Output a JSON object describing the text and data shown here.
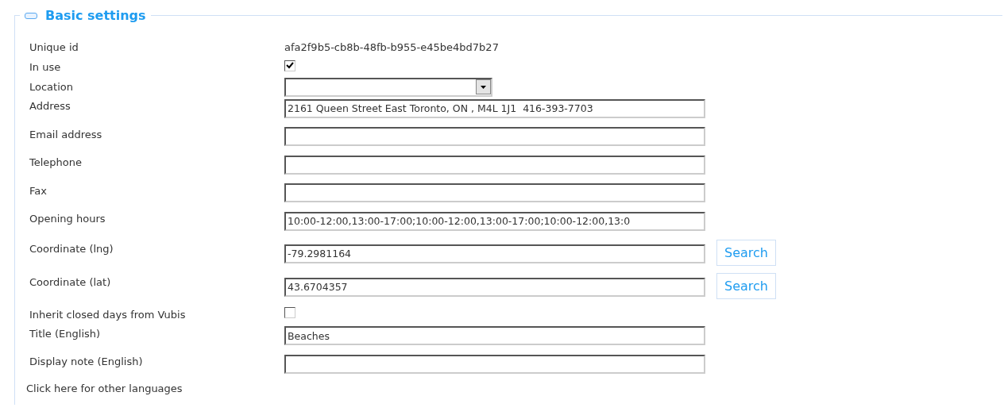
{
  "section": {
    "title": "Basic settings",
    "expanded": true
  },
  "fields": [
    {
      "kind": "text",
      "label": "Unique id",
      "value": "afa2f9b5-cb8b-48fb-b955-e45be4bd7b27"
    },
    {
      "kind": "checkbox",
      "label": "In use",
      "checked": true
    },
    {
      "kind": "select",
      "label": "Location"
    },
    {
      "kind": "input",
      "label": "Address",
      "value": "2161 Queen Street East Toronto, ON , M4L 1J1  416-393-7703"
    },
    {
      "kind": "input",
      "label": "Email address"
    },
    {
      "kind": "input",
      "label": "Telephone"
    },
    {
      "kind": "input",
      "label": "Fax"
    },
    {
      "kind": "input",
      "label": "Opening hours",
      "value": "10:00-12:00,13:00-17:00;10:00-12:00,13:00-17:00;10:00-12:00,13:0"
    },
    {
      "kind": "search",
      "label": "Coordinate (lng)",
      "value": "-79.2981164",
      "button": "Search"
    },
    {
      "kind": "search",
      "label": "Coordinate (lat)",
      "value": "43.6704357",
      "button": "Search"
    },
    {
      "kind": "checkbox",
      "label": "Inherit closed days from Vubis",
      "checked": false
    },
    {
      "kind": "input",
      "label": "Title (English)",
      "value": "Beaches"
    },
    {
      "kind": "input",
      "label": "Display note (English)"
    }
  ],
  "link": "Click here for other languages"
}
